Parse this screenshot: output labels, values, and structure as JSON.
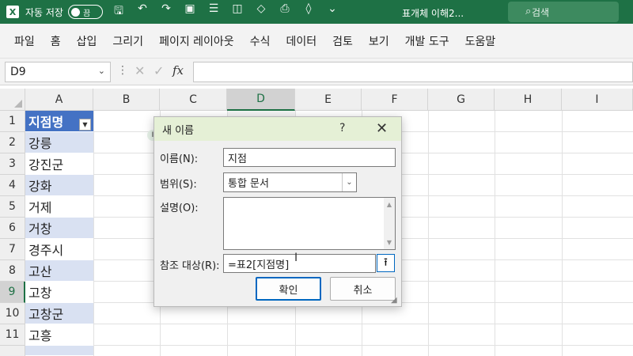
{
  "titlebar": {
    "autosave_label": "자동 저장",
    "autosave_state": "끔",
    "filename": "표개체 이해2...",
    "search_placeholder": "검색",
    "accent": "#1e7145"
  },
  "ribbon": {
    "tabs": [
      "파일",
      "홈",
      "삽입",
      "그리기",
      "페이지 레이아웃",
      "수식",
      "데이터",
      "검토",
      "보기",
      "개발 도구",
      "도움말"
    ]
  },
  "formula_bar": {
    "name_box": "D9",
    "fx_label": "fx",
    "formula": ""
  },
  "grid": {
    "columns": [
      "A",
      "B",
      "C",
      "D",
      "E",
      "F",
      "G",
      "H",
      "I"
    ],
    "selected_column": "D",
    "rows": [
      "1",
      "2",
      "3",
      "4",
      "5",
      "6",
      "7",
      "8",
      "9",
      "10",
      "11"
    ],
    "selected_row": "9",
    "column_a": [
      "지점명",
      "강릉",
      "강진군",
      "강화",
      "거제",
      "거창",
      "경주시",
      "고산",
      "고창",
      "고창군",
      "고흥"
    ],
    "table_header_color": "#4472c4",
    "table_band_color": "#d9e1f2"
  },
  "dialog": {
    "title": "새 이름",
    "help": "?",
    "name_label": "이름(N):",
    "name_value": "지점",
    "scope_label": "범위(S):",
    "scope_value": "통합 문서",
    "comment_label": "설명(O):",
    "comment_value": "",
    "refers_label": "참조 대상(R):",
    "refers_value": "=표2[지점명]",
    "ok_label": "확인",
    "cancel_label": "취소"
  }
}
